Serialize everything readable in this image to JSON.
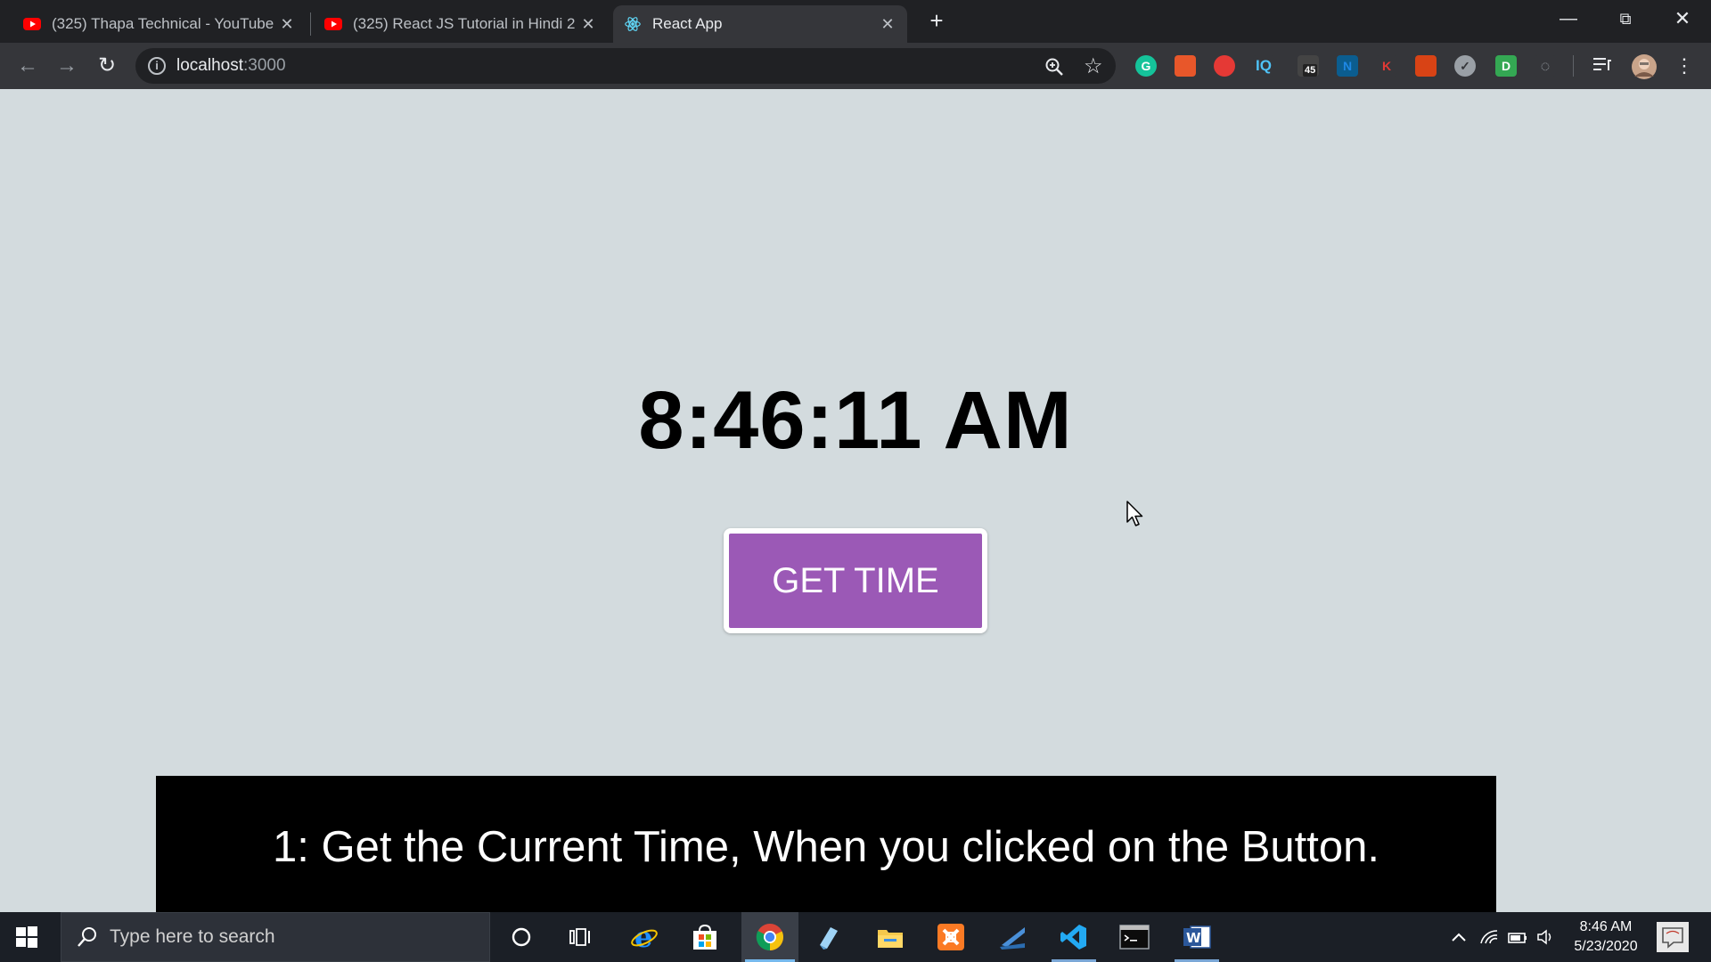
{
  "browser": {
    "tabs": [
      {
        "title": "(325) Thapa Technical - YouTube",
        "favicon": "youtube-icon",
        "active": false
      },
      {
        "title": "(325) React JS Tutorial in Hindi 2",
        "favicon": "youtube-icon",
        "active": false
      },
      {
        "title": "React App",
        "favicon": "react-icon",
        "active": true
      }
    ],
    "url_host": "localhost",
    "url_port": ":3000",
    "extension_badge": "45",
    "extensions": [
      {
        "name": "grammarly-icon",
        "color": "#15c39a",
        "glyph": "G"
      },
      {
        "name": "bookmark-ext-icon",
        "color": "#e8572a",
        "glyph": ""
      },
      {
        "name": "red-ext-icon",
        "color": "#e53935",
        "glyph": ""
      },
      {
        "name": "iq-ext-icon",
        "color": "#35363a",
        "glyph": "IQ"
      },
      {
        "name": "badge-ext-icon",
        "color": "#555",
        "glyph": ""
      },
      {
        "name": "n-ext-icon",
        "color": "#0b5d8f",
        "glyph": "N"
      },
      {
        "name": "k-ext-icon",
        "color": "#35363a",
        "glyph": "K"
      },
      {
        "name": "gift-ext-icon",
        "color": "#d84315",
        "glyph": ""
      },
      {
        "name": "check-ext-icon",
        "color": "#9aa0a6",
        "glyph": "✓"
      },
      {
        "name": "d-ext-icon",
        "color": "#34a853",
        "glyph": "D"
      },
      {
        "name": "grey-ext-icon",
        "color": "#35363a",
        "glyph": "◌"
      }
    ]
  },
  "page": {
    "time": "8:46:11 AM",
    "button_label": "GET TIME",
    "button_color": "#9b59b6",
    "caption": "1: Get the Current Time, When you clicked on the Button."
  },
  "taskbar": {
    "search_placeholder": "Type here to search",
    "time": "8:46 AM",
    "date": "5/23/2020"
  }
}
